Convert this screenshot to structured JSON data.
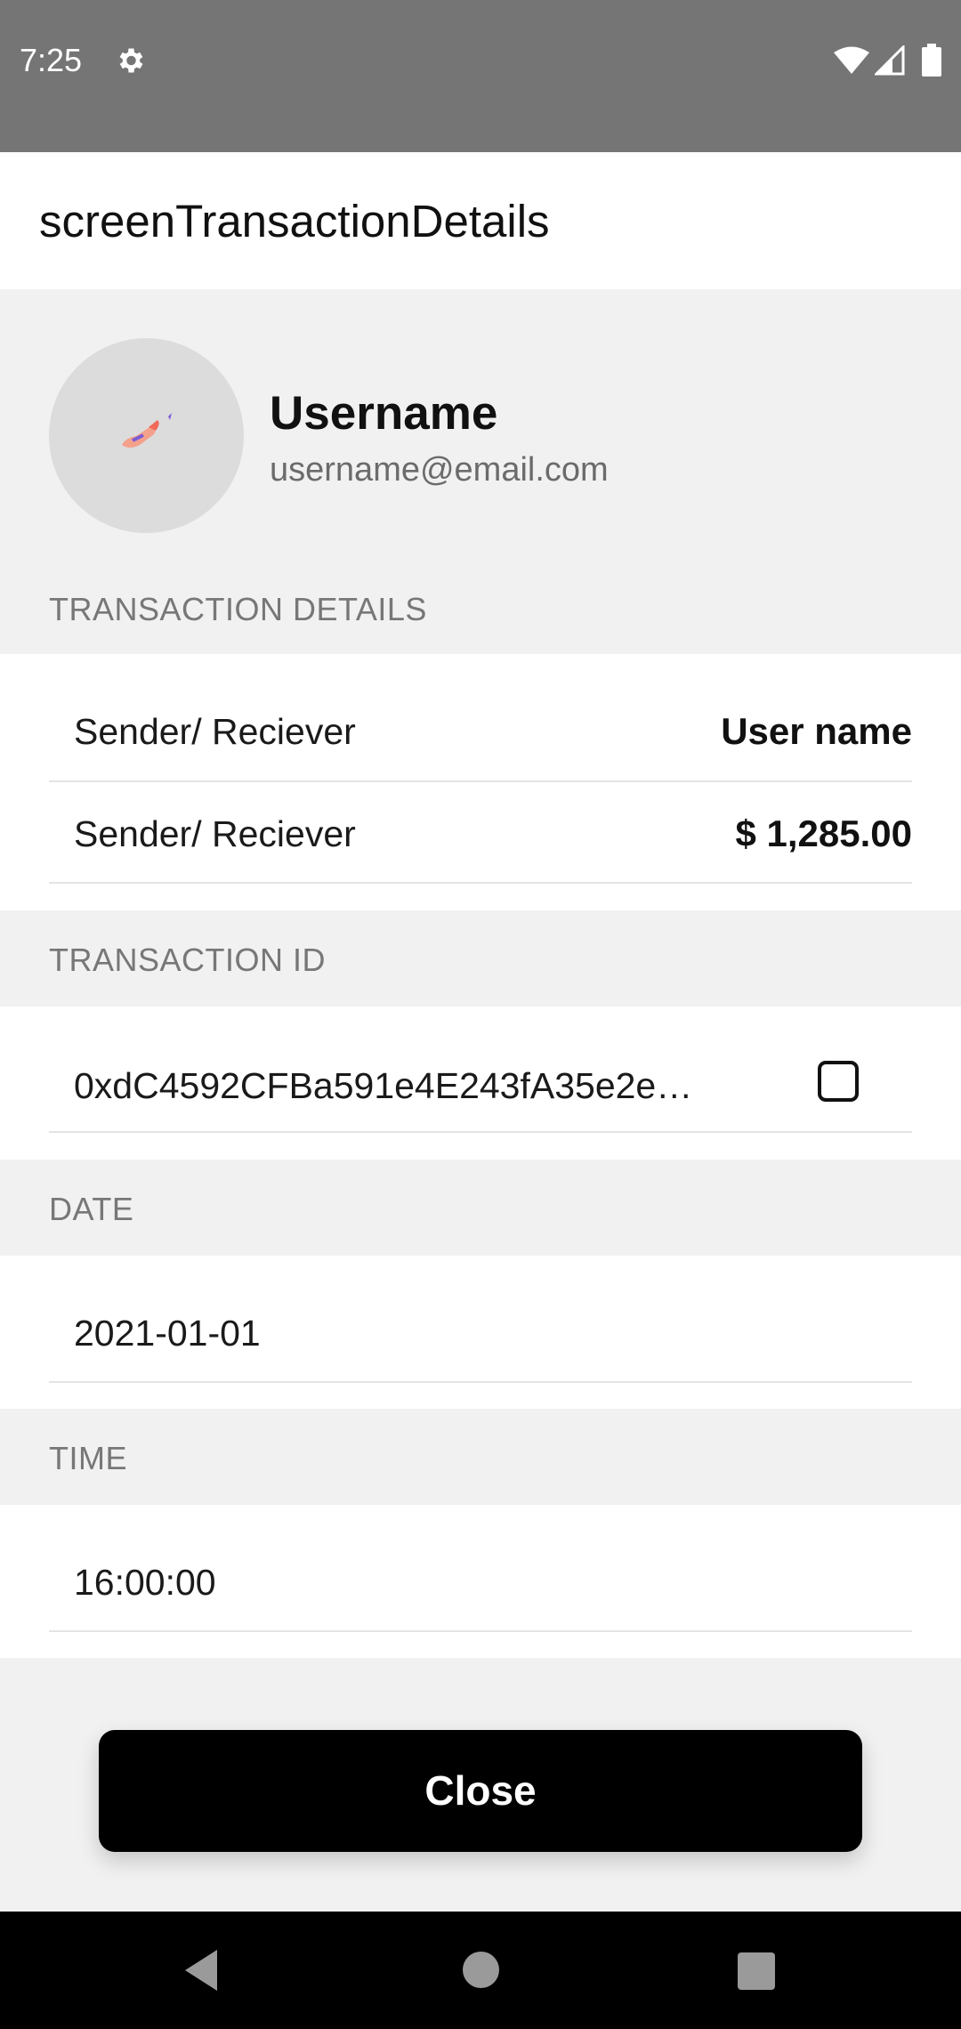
{
  "status_bar": {
    "time": "7:25",
    "icons": [
      "gear-icon",
      "wifi-icon",
      "signal-icon",
      "battery-icon"
    ]
  },
  "app_bar": {
    "title": "screenTransactionDetails"
  },
  "profile": {
    "name": "Username",
    "email": "username@email.com",
    "avatar_icon": "rocket-icon"
  },
  "sections": {
    "transaction_details": {
      "header": "TRANSACTION DETAILS",
      "rows": [
        {
          "label": "Sender/ Reciever",
          "value": "User name"
        },
        {
          "label": "Sender/ Reciever",
          "value": "$ 1,285.00"
        }
      ]
    },
    "transaction_id": {
      "header": "TRANSACTION ID",
      "value": "0xdC4592CFBa591e4E243fA35e2e…",
      "copy_icon": "copy-icon"
    },
    "date": {
      "header": "DATE",
      "value": "2021-01-01"
    },
    "time": {
      "header": "TIME",
      "value": "16:00:00"
    }
  },
  "close_button": {
    "label": "Close"
  },
  "nav_bar": {
    "icons": [
      "back-icon",
      "home-icon",
      "recents-icon"
    ]
  },
  "colors": {
    "status_bar": "#757575",
    "background": "#f1f1f1",
    "card": "#ffffff",
    "button": "#000000",
    "section_header_text": "#777777"
  }
}
